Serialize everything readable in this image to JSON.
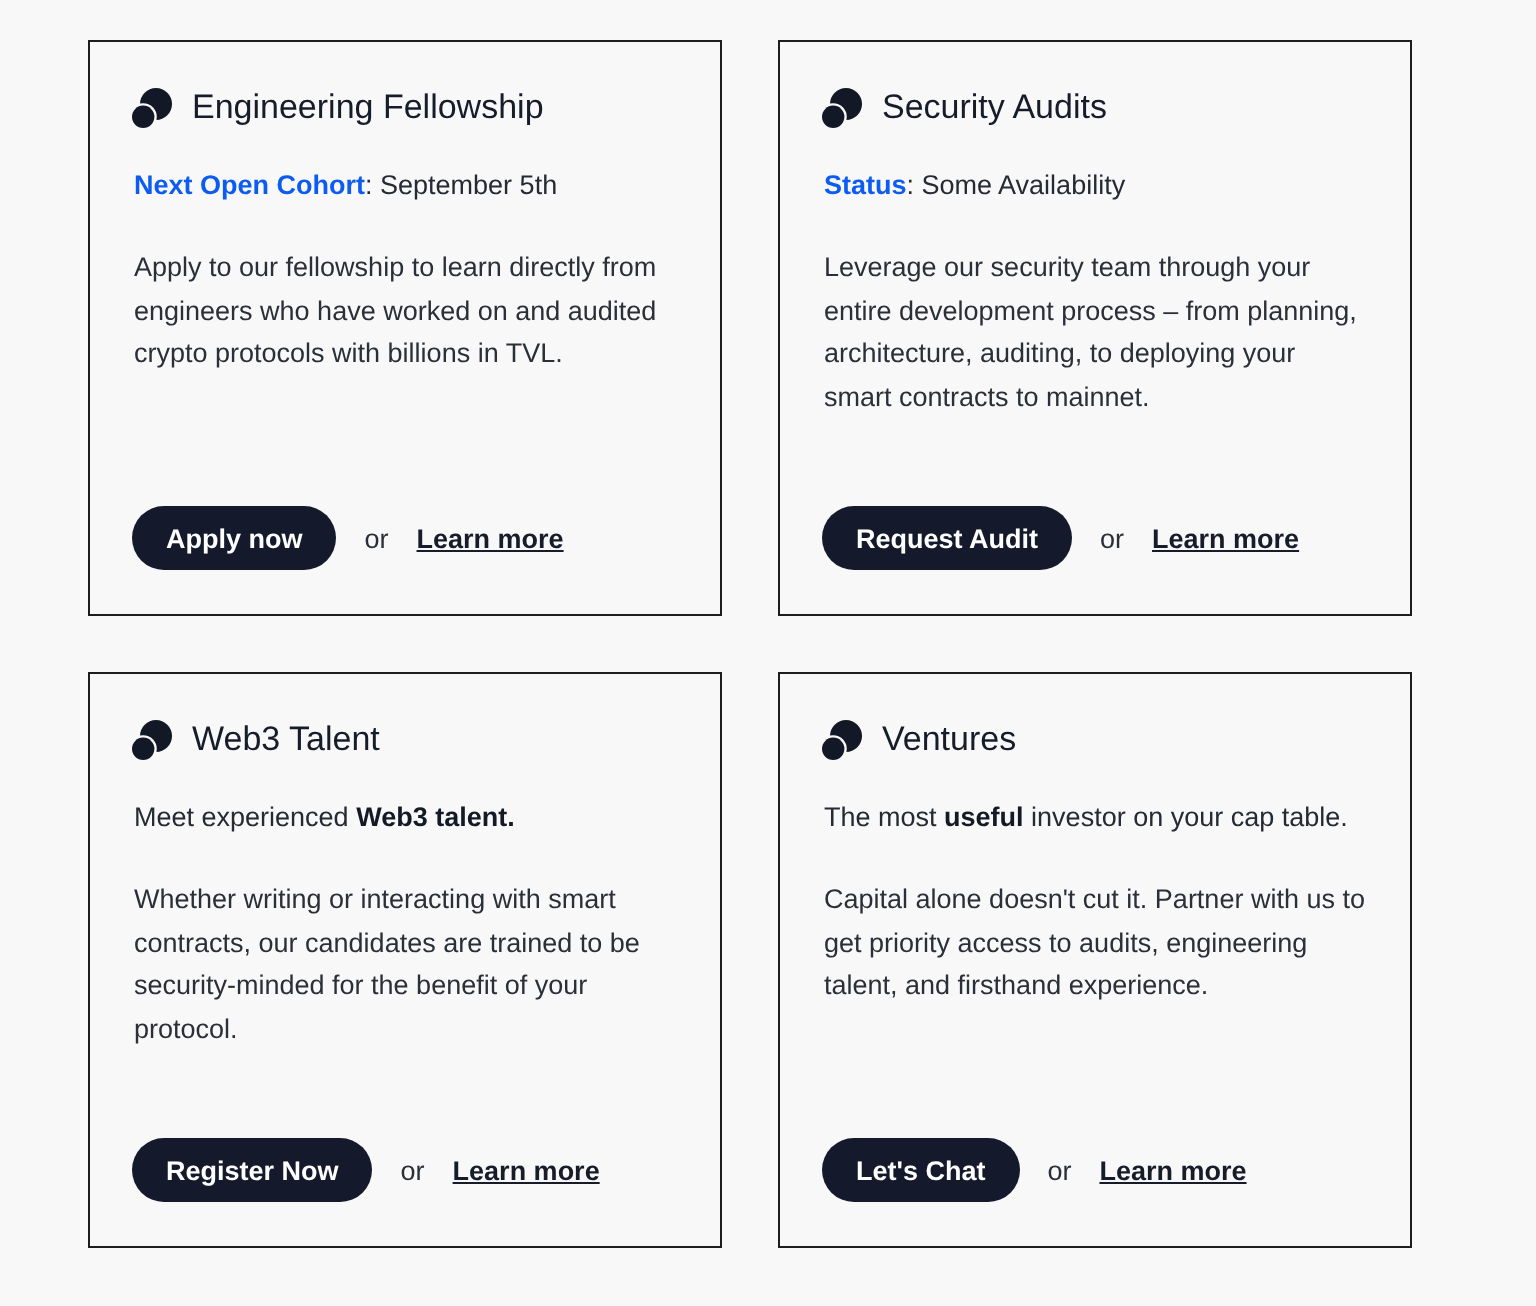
{
  "cards": [
    {
      "title": "Engineering Fellowship",
      "intro": {
        "kind": "status",
        "label": "Next Open Cohort",
        "text": ": September 5th"
      },
      "body": "Apply to our fellowship to learn directly from engineers who have worked on and audited crypto protocols with billions in TVL.",
      "action": "Apply now",
      "separator": "or",
      "link": "Learn more"
    },
    {
      "title": "Security Audits",
      "intro": {
        "kind": "status",
        "label": "Status",
        "text": ": Some Availability"
      },
      "body": "Leverage our security team through your entire development process – from planning, architecture, auditing, to deploying your smart contracts to mainnet.",
      "action": "Request Audit",
      "separator": "or",
      "link": "Learn more"
    },
    {
      "title": "Web3 Talent",
      "intro": {
        "kind": "lead",
        "text": "Meet experienced **Web3 talent.**"
      },
      "body": "Whether writing or interacting with smart contracts, our candidates are trained to be security-minded for the benefit of your protocol.",
      "action": "Register Now",
      "separator": "or",
      "link": "Learn more"
    },
    {
      "title": "Ventures",
      "intro": {
        "kind": "lead",
        "text": "The most **useful** investor on your cap table."
      },
      "body": "Capital alone doesn't cut it. Partner with us to get priority access to audits, engineering talent, and firsthand experience.",
      "action": "Let's Chat",
      "separator": "or",
      "link": "Learn more"
    }
  ]
}
